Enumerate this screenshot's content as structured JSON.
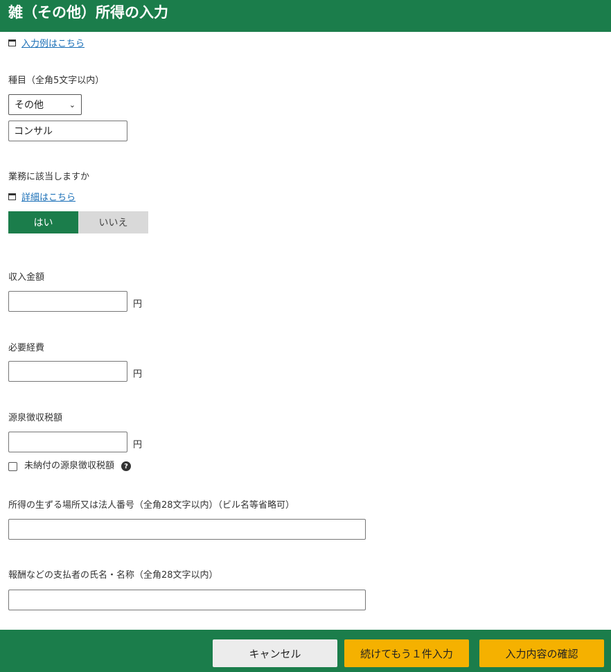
{
  "header": {
    "title": "雑（その他）所得の入力"
  },
  "example_link": "入力例はこちら",
  "category": {
    "label": "種目（全角5文字以内）",
    "selected": "その他",
    "text_value": "コンサル"
  },
  "business": {
    "label": "業務に該当しますか",
    "detail_link": "詳細はこちら",
    "yes_label": "はい",
    "no_label": "いいえ",
    "selected": "はい"
  },
  "revenue": {
    "label": "収入金額",
    "value": "",
    "unit": "円"
  },
  "expenses": {
    "label": "必要経費",
    "value": "",
    "unit": "円"
  },
  "withholding": {
    "label": "源泉徴収税額",
    "value": "",
    "unit": "円",
    "unpaid_checkbox_label": "未納付の源泉徴収税額"
  },
  "location": {
    "label": "所得の生ずる場所又は法人番号（全角28文字以内）（ビル名等省略可）",
    "value": ""
  },
  "payer": {
    "label": "報酬などの支払者の氏名・名称（全角28文字以内）",
    "value": ""
  },
  "footer": {
    "cancel_label": "キャンセル",
    "continue_label": "続けてもう１件入力",
    "confirm_label": "入力内容の確認"
  },
  "colors": {
    "brand_green": "#1b7d4b",
    "button_yellow": "#f5b100",
    "link_blue": "#1a6fb7"
  }
}
